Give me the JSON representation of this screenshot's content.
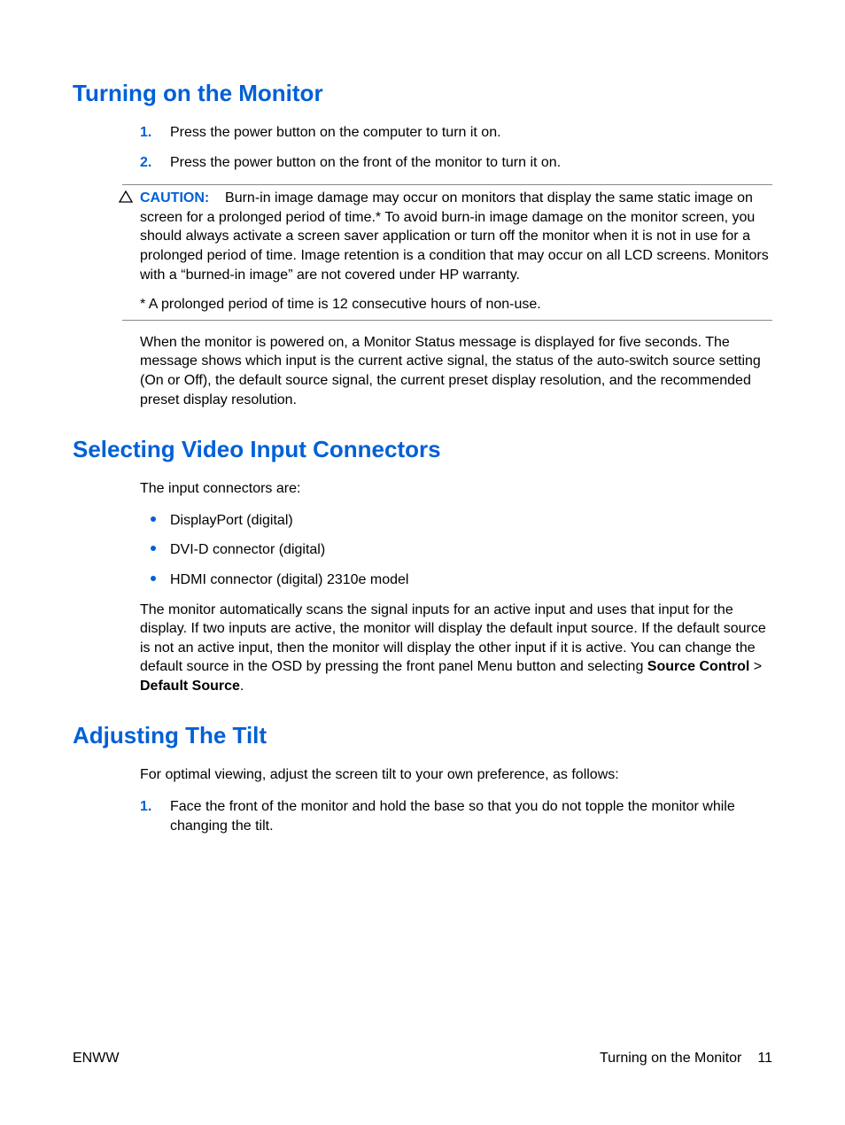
{
  "section1": {
    "heading": "Turning on the Monitor",
    "steps": [
      {
        "num": "1.",
        "text": "Press the power button on the computer to turn it on."
      },
      {
        "num": "2.",
        "text": "Press the power button on the front of the monitor to turn it on."
      }
    ],
    "caution": {
      "label": "CAUTION:",
      "para1_after": "Burn-in image damage may occur on monitors that display the same static image on screen for a prolonged period of time.* To avoid burn-in image damage on the monitor screen, you should always activate a screen saver application or turn off the monitor when it is not in use for a prolonged period of time. Image retention is a condition that may occur on all LCD screens. Monitors with a “burned-in image” are not covered under HP warranty.",
      "para2": "* A prolonged period of time is 12 consecutive hours of non-use."
    },
    "para_after": "When the monitor is powered on, a Monitor Status message is displayed for five seconds. The message shows which input is the current active signal, the status of the auto-switch source setting (On or Off), the default source signal, the current preset display resolution, and the recommended preset display resolution."
  },
  "section2": {
    "heading": "Selecting Video Input Connectors",
    "intro": "The input connectors are:",
    "bullets": [
      "DisplayPort (digital)",
      "DVI-D connector (digital)",
      "HDMI connector (digital) 2310e model"
    ],
    "source_para_pre": "The monitor automatically scans the signal inputs for an active input and uses that input for the display. If two inputs are active, the monitor will display the default input source. If the default source is not an active input, then the monitor will display the other input if it is active. You can change the default source in the OSD by pressing the front panel Menu button and selecting ",
    "bold1": "Source Control",
    "gt": " > ",
    "bold2": "Default Source",
    "period": "."
  },
  "section3": {
    "heading": "Adjusting The Tilt",
    "intro": "For optimal viewing, adjust the screen tilt to your own preference, as follows:",
    "steps": [
      {
        "num": "1.",
        "text": "Face the front of the monitor and hold the base so that you do not topple the monitor while changing the tilt."
      }
    ]
  },
  "footer": {
    "left": "ENWW",
    "right_label": "Turning on the Monitor",
    "page": "11"
  }
}
